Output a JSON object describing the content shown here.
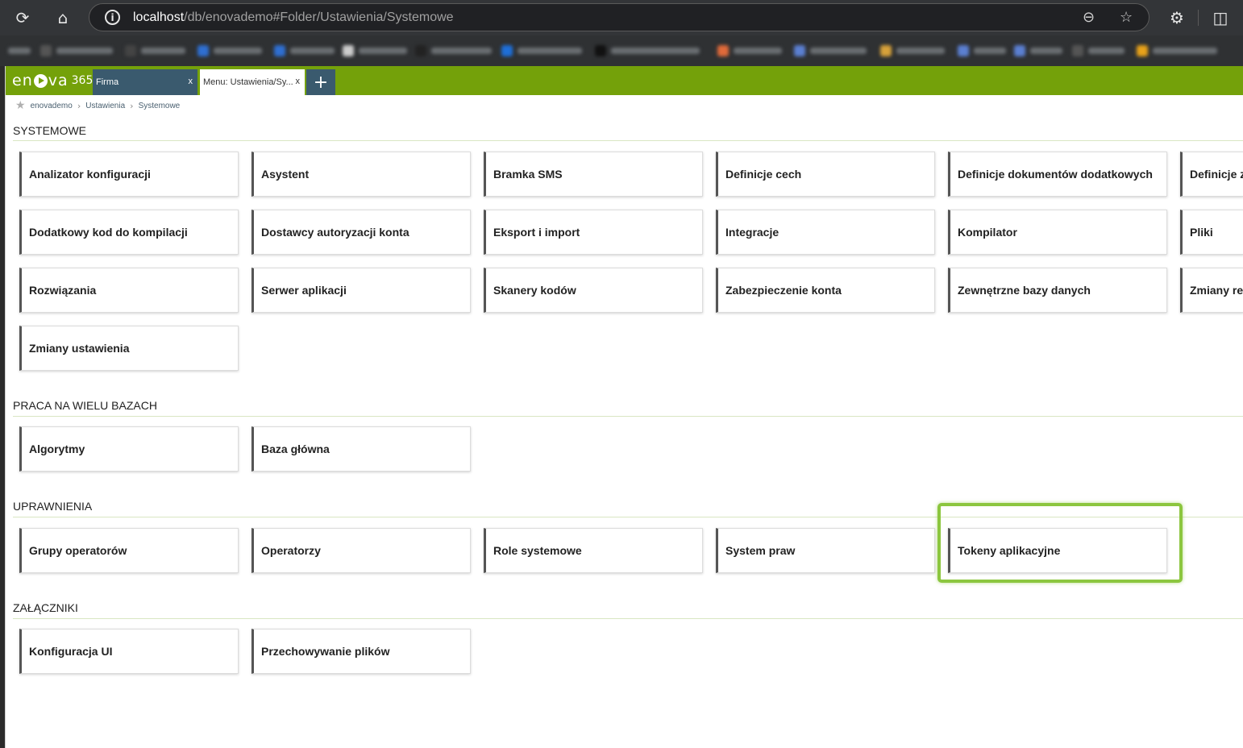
{
  "browser": {
    "url_host": "localhost",
    "url_path": "/db/enovademo#Folder/Ustawienia/Systemowe"
  },
  "app": {
    "logo_text": "en",
    "logo_text2": "va",
    "logo_num": "365",
    "tabs": [
      {
        "label": "Firma",
        "close": "x"
      },
      {
        "label": "Menu: Ustawienia/Sy...",
        "close": "x"
      }
    ],
    "add_tab": "+"
  },
  "breadcrumb": [
    "enovademo",
    "Ustawienia",
    "Systemowe"
  ],
  "sections": [
    {
      "title": "SYSTEMOWE",
      "tiles": [
        "Analizator konfiguracji",
        "Asystent",
        "Bramka SMS",
        "Definicje cech",
        "Definicje dokumentów dodatkowych",
        "Definicje z",
        "Dodatkowy kod do kompilacji",
        "Dostawcy autoryzacji konta",
        "Eksport i import",
        "Integracje",
        "Kompilator",
        "Pliki",
        "Rozwiązania",
        "Serwer aplikacji",
        "Skanery kodów",
        "Zabezpieczenie konta",
        "Zewnętrzne bazy danych",
        "Zmiany rek",
        "Zmiany ustawienia"
      ]
    },
    {
      "title": "PRACA NA WIELU BAZACH",
      "tiles": [
        "Algorytmy",
        "Baza główna"
      ]
    },
    {
      "title": "UPRAWNIENIA",
      "tiles": [
        "Grupy operatorów",
        "Operatorzy",
        "Role systemowe",
        "System praw",
        "Tokeny aplikacyjne"
      ]
    },
    {
      "title": "ZAŁĄCZNIKI",
      "tiles": [
        "Konfiguracja UI",
        "Przechowywanie plików"
      ]
    }
  ],
  "colors": {
    "header_green": "#74a10a",
    "tab_dark": "#3a5a6e",
    "highlight": "#8cc63f"
  }
}
